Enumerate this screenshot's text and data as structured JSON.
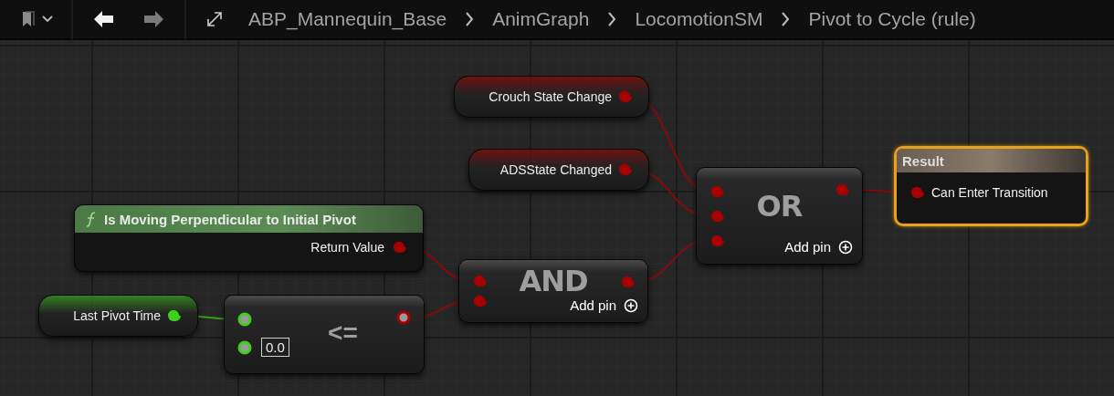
{
  "toolbar": {
    "back_button": {
      "disabled": false
    },
    "forward_button": {
      "disabled": true
    },
    "breadcrumbs": [
      "ABP_Mannequin_Base",
      "AnimGraph",
      "LocomotionSM",
      "Pivot to Cycle (rule)"
    ]
  },
  "graph": {
    "nodes": [
      {
        "kind": "variable",
        "label": "Crouch State Change",
        "pin": {
          "color": "#a80000",
          "hollow": false
        }
      },
      {
        "kind": "variable",
        "label": "ADSState Changed",
        "pin": {
          "color": "#a80000",
          "hollow": false
        }
      },
      {
        "kind": "function",
        "title": "Is Moving Perpendicular to Initial Pivot",
        "outputs": [
          {
            "color": "#a80000",
            "label": "Return Value",
            "hollow": false
          }
        ]
      },
      {
        "kind": "variable",
        "label": "Last Pivot Time",
        "pin": {
          "color": "#3fd01c",
          "hollow": false
        }
      },
      {
        "kind": "operator",
        "symbol": "<=",
        "inputs": [
          {
            "color": "#3fd01c",
            "hollow": true
          },
          {
            "color": "#3fd01c",
            "hollow": true,
            "value": "0.0"
          }
        ],
        "outputs": [
          {
            "color": "#a80000",
            "hollow": true
          }
        ]
      },
      {
        "kind": "operator",
        "symbol": "AND",
        "add_pin": "Add pin",
        "inputs": [
          {
            "color": "#a80000",
            "hollow": false
          },
          {
            "color": "#a80000",
            "hollow": false
          }
        ],
        "outputs": [
          {
            "color": "#a80000",
            "hollow": false
          }
        ]
      },
      {
        "kind": "operator",
        "symbol": "OR",
        "add_pin": "Add pin",
        "inputs": [
          {
            "color": "#a80000",
            "hollow": false
          },
          {
            "color": "#a80000",
            "hollow": false
          },
          {
            "color": "#a80000",
            "hollow": false
          }
        ],
        "outputs": [
          {
            "color": "#a80000",
            "hollow": false
          }
        ]
      },
      {
        "kind": "result",
        "title": "Result",
        "selected": true,
        "inputs": [
          {
            "color": "#a80000",
            "label": "Can Enter Transition",
            "hollow": false
          }
        ]
      }
    ]
  }
}
